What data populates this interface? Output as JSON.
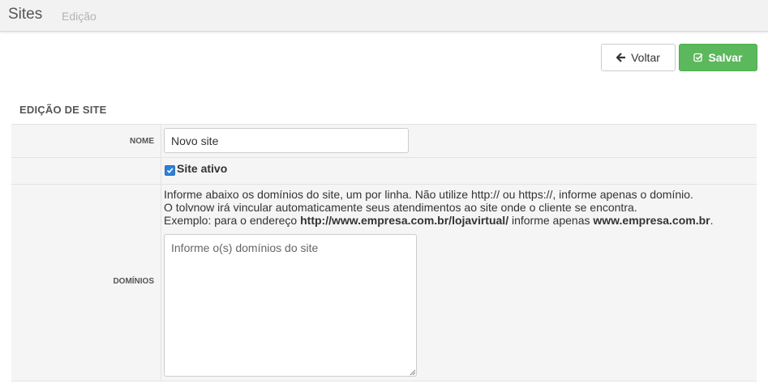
{
  "header": {
    "title": "Sites",
    "subtitle": "Edição"
  },
  "toolbar": {
    "back_label": "Voltar",
    "save_label": "Salvar"
  },
  "section": {
    "title": "EDIÇÃO DE SITE"
  },
  "form": {
    "nome": {
      "label": "NOME",
      "value": "Novo site"
    },
    "ativo": {
      "label": "Site ativo",
      "checked": true
    },
    "dominios": {
      "label": "DOMÍNIOS",
      "help_line1": "Informe abaixo os domínios do site, um por linha. Não utilize http:// ou https://, informe apenas o domínio.",
      "help_line2": "O tolvnow irá vincular automaticamente seus atendimentos ao site onde o cliente se encontra.",
      "help_line3_prefix": "Exemplo: para o endereço ",
      "help_line3_url": "http://www.empresa.com.br/lojavirtual/",
      "help_line3_mid": " informe apenas ",
      "help_line3_domain": "www.empresa.com.br",
      "help_line3_suffix": ".",
      "placeholder": "Informe o(s) domínios do site",
      "value": ""
    }
  },
  "icons": {
    "back": "arrow-left-icon",
    "save": "check-square-icon",
    "checkbox": "checkmark-icon"
  },
  "colors": {
    "save_button": "#5cb85c",
    "checkbox": "#2e80d8"
  }
}
